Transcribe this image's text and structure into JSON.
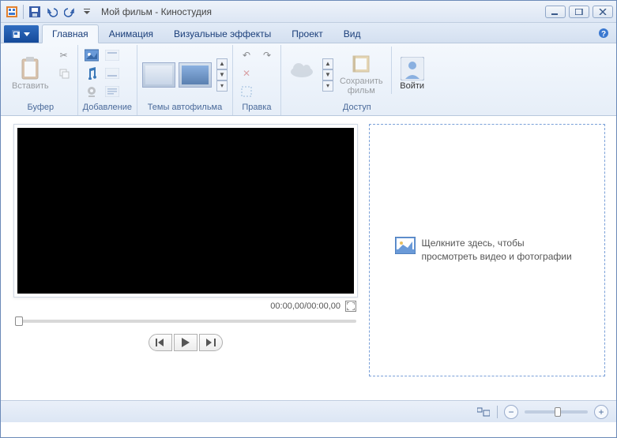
{
  "window": {
    "title": "Мой фильм - Киностудия",
    "controls": {
      "min": "minimize",
      "max": "maximize",
      "close": "close"
    }
  },
  "qat": {
    "icons": [
      "app-icon",
      "save-icon",
      "undo-icon",
      "redo-icon",
      "dropdown-icon"
    ]
  },
  "tabs": {
    "file_label": "",
    "items": [
      "Главная",
      "Анимация",
      "Визуальные эффекты",
      "Проект",
      "Вид"
    ],
    "active_index": 0,
    "help": "?"
  },
  "ribbon": {
    "groups": {
      "buffer": {
        "label": "Буфер",
        "paste": "Вставить"
      },
      "add": {
        "label": "Добавление"
      },
      "themes": {
        "label": "Темы автофильма"
      },
      "edit": {
        "label": "Правка"
      },
      "access": {
        "label": "Доступ",
        "save_movie": "Сохранить\nфильм",
        "signin": "Войти"
      }
    }
  },
  "preview": {
    "timecode": "00:00,00/00:00,00"
  },
  "dropzone": {
    "text": "Щелкните здесь, чтобы просмотреть видео и фотографии"
  },
  "statusbar": {
    "zoom_value": 50
  }
}
